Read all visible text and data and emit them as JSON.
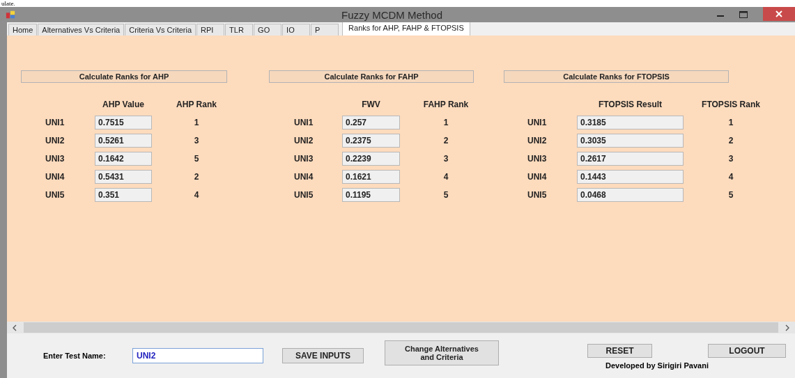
{
  "page_text_above": "ulate.",
  "window": {
    "title": "Fuzzy MCDM Method"
  },
  "tabs": [
    {
      "label": "Home",
      "selected": false
    },
    {
      "label": "Alternatives Vs Criteria",
      "selected": false
    },
    {
      "label": "Criteria Vs Criteria",
      "selected": false
    },
    {
      "label": "RPI",
      "selected": false
    },
    {
      "label": "TLR",
      "selected": false
    },
    {
      "label": "GO",
      "selected": false
    },
    {
      "label": "IO",
      "selected": false
    },
    {
      "label": "P",
      "selected": false
    },
    {
      "label": "Ranks for AHP, FAHP & FTOPSIS",
      "selected": true
    }
  ],
  "sections": [
    {
      "button": "Calculate Ranks for AHP",
      "value_header": "AHP Value",
      "rank_header": "AHP Rank",
      "rows": [
        {
          "name": "UNI1",
          "value": "0.7515",
          "rank": "1"
        },
        {
          "name": "UNI2",
          "value": "0.5261",
          "rank": "3"
        },
        {
          "name": "UNI3",
          "value": "0.1642",
          "rank": "5"
        },
        {
          "name": "UNI4",
          "value": "0.5431",
          "rank": "2"
        },
        {
          "name": "UNI5",
          "value": "0.351",
          "rank": "4"
        }
      ]
    },
    {
      "button": "Calculate Ranks for FAHP",
      "value_header": "FWV",
      "rank_header": "FAHP Rank",
      "rows": [
        {
          "name": "UNI1",
          "value": "0.257",
          "rank": "1"
        },
        {
          "name": "UNI2",
          "value": "0.2375",
          "rank": "2"
        },
        {
          "name": "UNI3",
          "value": "0.2239",
          "rank": "3"
        },
        {
          "name": "UNI4",
          "value": "0.1621",
          "rank": "4"
        },
        {
          "name": "UNI5",
          "value": "0.1195",
          "rank": "5"
        }
      ]
    },
    {
      "button": "Calculate Ranks for FTOPSIS",
      "value_header": "FTOPSIS Result",
      "rank_header": "FTOPSIS Rank",
      "rows": [
        {
          "name": "UNI1",
          "value": "0.3185",
          "rank": "1"
        },
        {
          "name": "UNI2",
          "value": "0.3035",
          "rank": "2"
        },
        {
          "name": "UNI3",
          "value": "0.2617",
          "rank": "3"
        },
        {
          "name": "UNI4",
          "value": "0.1443",
          "rank": "4"
        },
        {
          "name": "UNI5",
          "value": "0.0468",
          "rank": "5"
        }
      ]
    }
  ],
  "footer": {
    "test_name_label": "Enter Test Name:",
    "test_name_value": "UNI2",
    "save_button": "SAVE INPUTS",
    "change_button": "Change Alternatives and Criteria",
    "reset_button": "RESET",
    "logout_button": "LOGOUT",
    "credit": "Developed by Sirigiri Pavani"
  }
}
